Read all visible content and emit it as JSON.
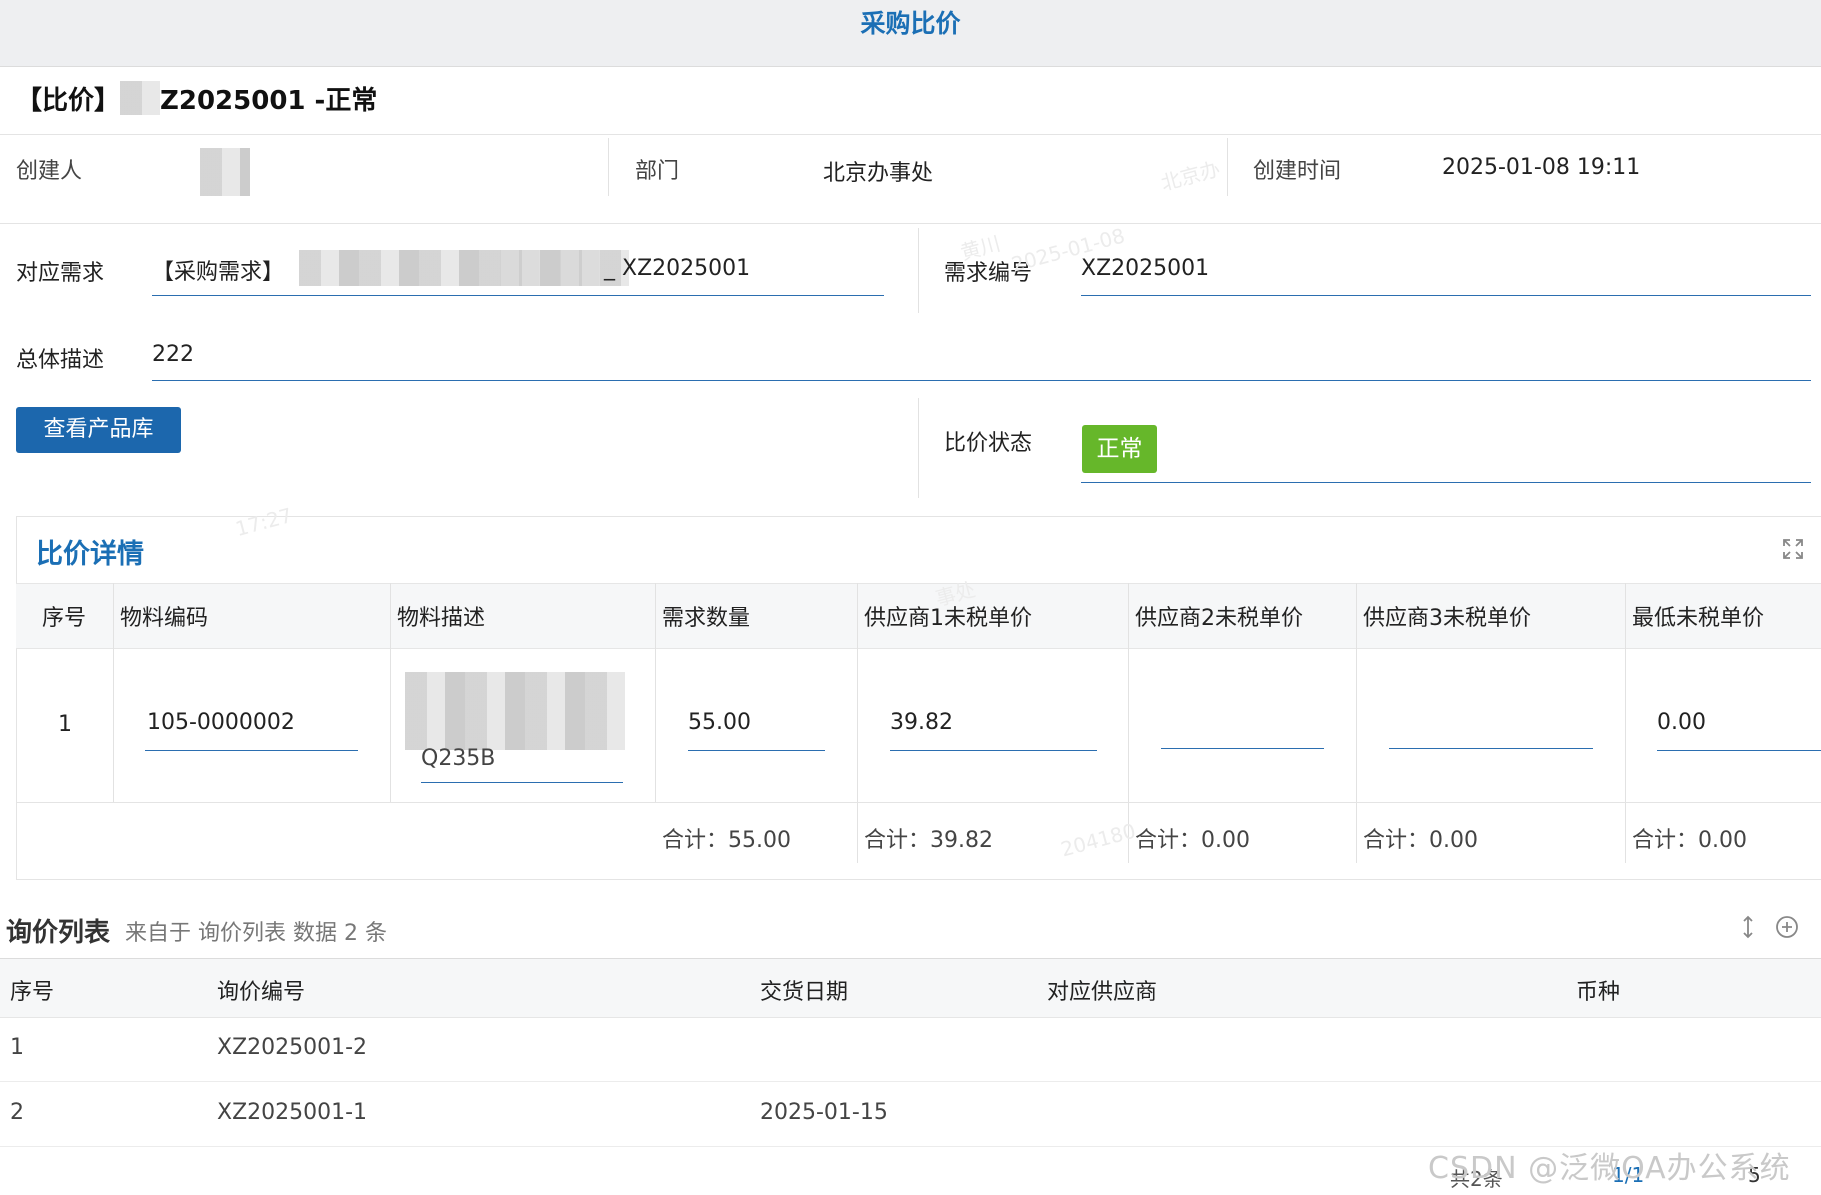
{
  "app": {
    "title": "采购比价"
  },
  "record": {
    "title_prefix": "【比价】",
    "title_suffix": "Z2025001 -正常"
  },
  "meta": {
    "creator_label": "创建人",
    "dept_label": "部门",
    "dept_value": "北京办事处",
    "created_label": "创建时间",
    "created_value": "2025-01-08 19:11"
  },
  "form": {
    "demand_label": "对应需求",
    "demand_prefix": "【采购需求】",
    "demand_suffix": "_ XZ2025001",
    "demand_no_label": "需求编号",
    "demand_no_value": "XZ2025001",
    "desc_label": "总体描述",
    "desc_value": "222",
    "view_products_button": "查看产品库",
    "status_label": "比价状态",
    "status_value": "正常",
    "status_color": "#66b72a",
    "accent_color": "#1b6fb5"
  },
  "detail": {
    "title": "比价详情",
    "expand_icon": "expand-icon",
    "headers": [
      "序号",
      "物料编码",
      "物料描述",
      "需求数量",
      "供应商1未税单价",
      "供应商2未税单价",
      "供应商3未税单价",
      "最低未税单价"
    ],
    "row": {
      "index": "1",
      "code": "105-0000002",
      "desc_tail": "Q235B",
      "qty": "55.00",
      "price1": "39.82",
      "price2": "",
      "price3": "",
      "min_price": "0.00"
    },
    "totals": {
      "qty": "合计：55.00",
      "price1": "合计：39.82",
      "price2": "合计：0.00",
      "price3": "合计：0.00",
      "min_price": "合计：0.00"
    }
  },
  "inquiry": {
    "title": "询价列表",
    "subtitle": "来自于 询价列表 数据 2 条",
    "headers": [
      "序号",
      "询价编号",
      "交货日期",
      "对应供应商",
      "币种"
    ],
    "rows": [
      {
        "index": "1",
        "no": "XZ2025001-2",
        "date": "",
        "supplier": "",
        "currency": ""
      },
      {
        "index": "2",
        "no": "XZ2025001-1",
        "date": "2025-01-15",
        "supplier": "",
        "currency": ""
      }
    ],
    "pager_total": "共2条",
    "pager_page": "1/1",
    "pager_size": "5"
  },
  "watermark": {
    "brand": "CSDN @泛微OA办公系统",
    "texts": [
      "北京办",
      "黄川",
      "2025-01-08",
      "17:27",
      "事处",
      "204180"
    ]
  }
}
